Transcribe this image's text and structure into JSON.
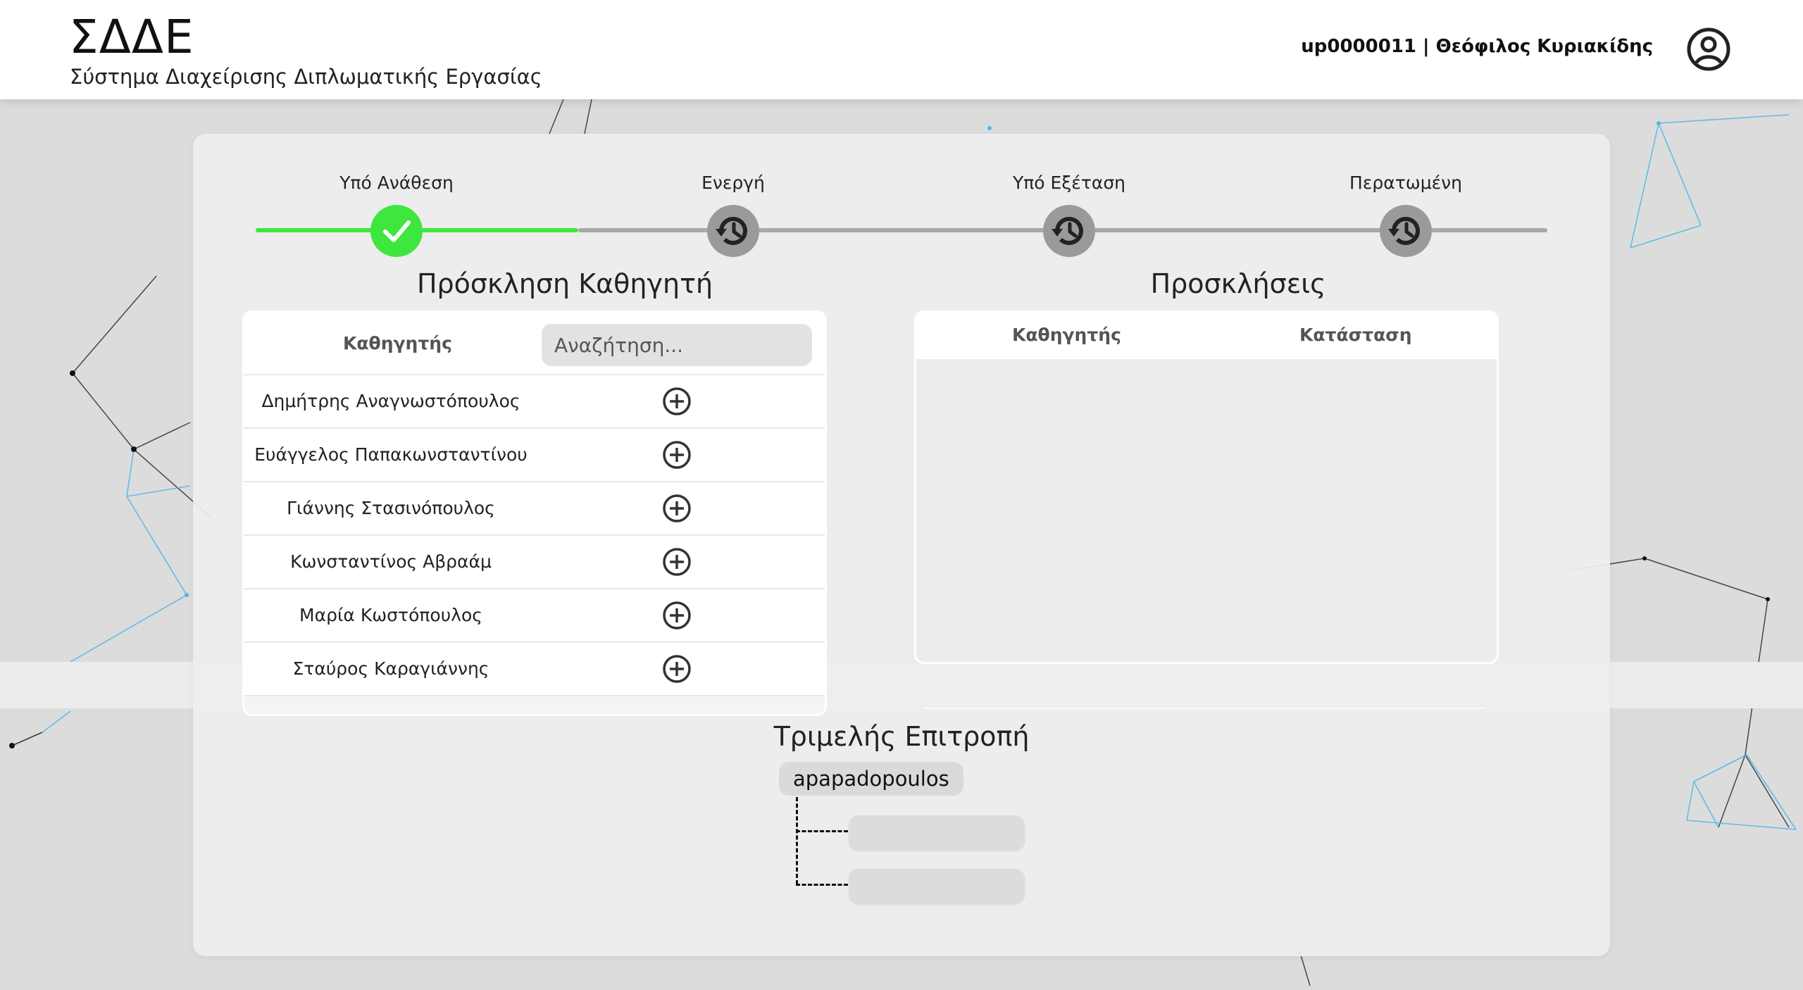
{
  "header": {
    "brand": "ΣΔΔΕ",
    "subtitle": "Σύστημα Διαχείρισης Διπλωματικής Εργασίας",
    "user": "up0000011 | Θεόφιλος Κυριακίδης"
  },
  "progress": {
    "steps": [
      {
        "label": "Υπό Ανάθεση",
        "status": "done",
        "icon": "check-icon"
      },
      {
        "label": "Ενεργή",
        "status": "pending",
        "icon": "history-icon"
      },
      {
        "label": "Υπό Εξέταση",
        "status": "pending",
        "icon": "history-icon"
      },
      {
        "label": "Περατωμένη",
        "status": "pending",
        "icon": "history-icon"
      }
    ],
    "done_color": "#3ee63e",
    "pending_color": "#9a9a9a"
  },
  "invite": {
    "title": "Πρόσκληση Καθηγητή",
    "column_professor": "Καθηγητής",
    "search_placeholder": "Αναζήτηση...",
    "professors": [
      "Δημήτρης Αναγνωστόπουλος",
      "Ευάγγελος Παπακωνσταντίνου",
      "Γιάννης Στασινόπουλος",
      "Κωνσταντίνος Αβραάμ",
      "Μαρία Κωστόπουλος",
      "Σταύρος Καραγιάννης"
    ],
    "add_icon": "plus-circle-icon"
  },
  "invitations": {
    "title": "Προσκλήσεις",
    "column_professor": "Καθηγητής",
    "column_status": "Κατάσταση"
  },
  "committee": {
    "title": "Τριμελής Επιτροπή",
    "supervisor": "apapadopoulos"
  }
}
